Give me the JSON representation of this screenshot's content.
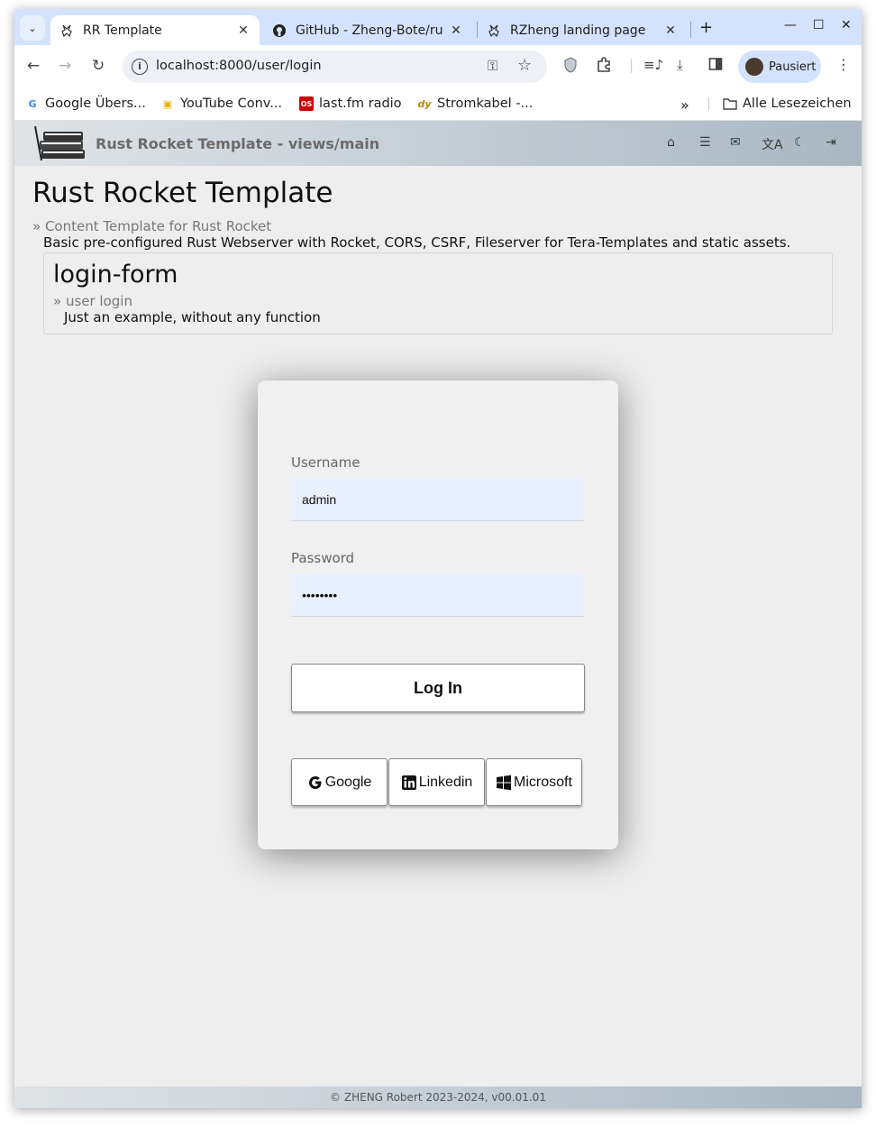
{
  "browser": {
    "tabs": [
      {
        "title": "RR Template",
        "favicon": "rabbit-icon",
        "active": true
      },
      {
        "title": "GitHub - Zheng-Bote/ru",
        "favicon": "github-icon",
        "active": false
      },
      {
        "title": "RZheng landing page",
        "favicon": "rabbit-icon",
        "active": false
      }
    ],
    "url": "localhost:8000/user/login",
    "profile_label": "Pausiert",
    "bookmarks": [
      {
        "label": "Google Übers...",
        "icon": "google-icon"
      },
      {
        "label": "YouTube Conv...",
        "icon": "video-icon"
      },
      {
        "label": "last.fm radio",
        "icon": "lastfm-icon"
      },
      {
        "label": "Stromkabel -...",
        "icon": "dy-icon"
      }
    ],
    "bookmarks_folder": "Alle Lesezeichen"
  },
  "app": {
    "title": "Rust Rocket Template - views/main",
    "heading": "Rust Rocket Template",
    "subheading": "» Content Template for Rust Rocket",
    "description": "Basic pre-configured Rust Webserver with Rocket, CORS, CSRF, Fileserver for Tera-Templates and static assets.",
    "card": {
      "heading": "login-form",
      "subheading": "» user login",
      "description": "Just an example, without any function"
    },
    "login": {
      "username_label": "Username",
      "username_value": "admin",
      "password_label": "Password",
      "password_value": "••••••••",
      "submit_label": "Log In",
      "sso": [
        {
          "label": "Google",
          "icon": "google-g-icon"
        },
        {
          "label": "Linkedin",
          "icon": "linkedin-icon"
        },
        {
          "label": "Microsoft",
          "icon": "windows-icon"
        }
      ]
    },
    "footer": "© ZHENG Robert 2023-2024, v00.01.01"
  }
}
